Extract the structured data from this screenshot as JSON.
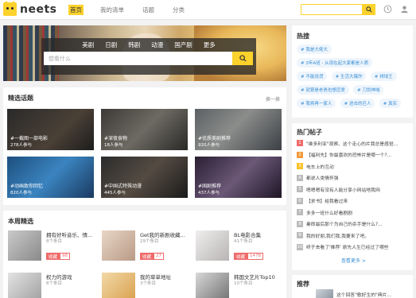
{
  "header": {
    "logo_text": "neets",
    "nav": [
      {
        "label": "首页",
        "active": true
      },
      {
        "label": "我的清单",
        "active": false
      },
      {
        "label": "话题",
        "active": false
      },
      {
        "label": "分类",
        "active": false
      }
    ],
    "search_placeholder": ""
  },
  "banner": {
    "categories": [
      "美剧",
      "日剧",
      "韩剧",
      "动漫",
      "国产剧",
      "更多"
    ],
    "search_placeholder": "想看什么"
  },
  "topics": {
    "title": "精选话题",
    "more": "换一换",
    "items": [
      {
        "caption": "#一截图一部电影",
        "sub": "278人参与"
      },
      {
        "caption": "#深夜食物",
        "sub": "18人参与"
      },
      {
        "caption": "#优质美剧推荐",
        "sub": "920人参与"
      },
      {
        "caption": "#动画致你回忆",
        "sub": "820人参与"
      },
      {
        "caption": "#中国式特殊动漫",
        "sub": "445人参与"
      },
      {
        "caption": "#国剧推荐",
        "sub": "437人参与"
      }
    ]
  },
  "weekly": {
    "title": "本周精选",
    "items": [
      {
        "name": "拥有好听音乐、情...",
        "count": "8个条目",
        "tag": "收藏",
        "num": "98"
      },
      {
        "name": "Get我的新剧收藏...",
        "count": "29个条目",
        "tag": "收藏",
        "num": "27"
      },
      {
        "name": "BL电影合集",
        "count": "41个条目",
        "tag": "收藏",
        "num": "1478"
      },
      {
        "name": "权力的游戏",
        "count": "8个条目",
        "tag": "",
        "num": ""
      },
      {
        "name": "我的草单地址",
        "count": "3个条目",
        "tag": "",
        "num": ""
      },
      {
        "name": "韩国文艺片Top10",
        "count": "10个条目",
        "tag": "",
        "num": ""
      }
    ]
  },
  "hot_search": {
    "title": "热搜",
    "tags": [
      "我是大佬大",
      "3年A班 - 从现在起大家都是人质",
      "不能说谎",
      "生活大爆炸",
      "排球王",
      "就算是老爸也想恋爱",
      "刀剑神域",
      "我将再一家人",
      "进击的巨人",
      "真实"
    ]
  },
  "hot_posts": {
    "title": "热门帖子",
    "more": "查看更多 >",
    "items": [
      {
        "rank": "1",
        "color": "#ef6b6b",
        "title": "\"维多利亚\"观察、这个走心的片我总是感觉..."
      },
      {
        "rank": "2",
        "color": "#f39a3b",
        "title": "【福利先】你最喜欢的恐怖片是哪一个?..."
      },
      {
        "rank": "3",
        "color": "#fcc22c",
        "title": "电车上的互动"
      },
      {
        "rank": "4",
        "color": "#bbbbbb",
        "title": "都说人类情怀强"
      },
      {
        "rank": "5",
        "color": "#bbbbbb",
        "title": "嗯嗯嗯有没有人能分享小网站啥我网"
      },
      {
        "rank": "6",
        "color": "#bbbbbb",
        "title": "【求书】给我看过来"
      },
      {
        "rank": "7",
        "color": "#bbbbbb",
        "title": "多多一班什么好看剧剧"
      },
      {
        "rank": "8",
        "color": "#bbbbbb",
        "title": "秦郎最后那个为自己的杀手是什么?..."
      },
      {
        "rank": "9",
        "color": "#bbbbbb",
        "title": "我的好朋,我们我,我要来了吧。"
      },
      {
        "rank": "10",
        "color": "#bbbbbb",
        "title": "终于去看了'推荐' 原先人生已经过了哪些"
      }
    ]
  },
  "recommend": {
    "title": "推荐",
    "item_title": "这个回答\"歌好生的\"典片..."
  }
}
